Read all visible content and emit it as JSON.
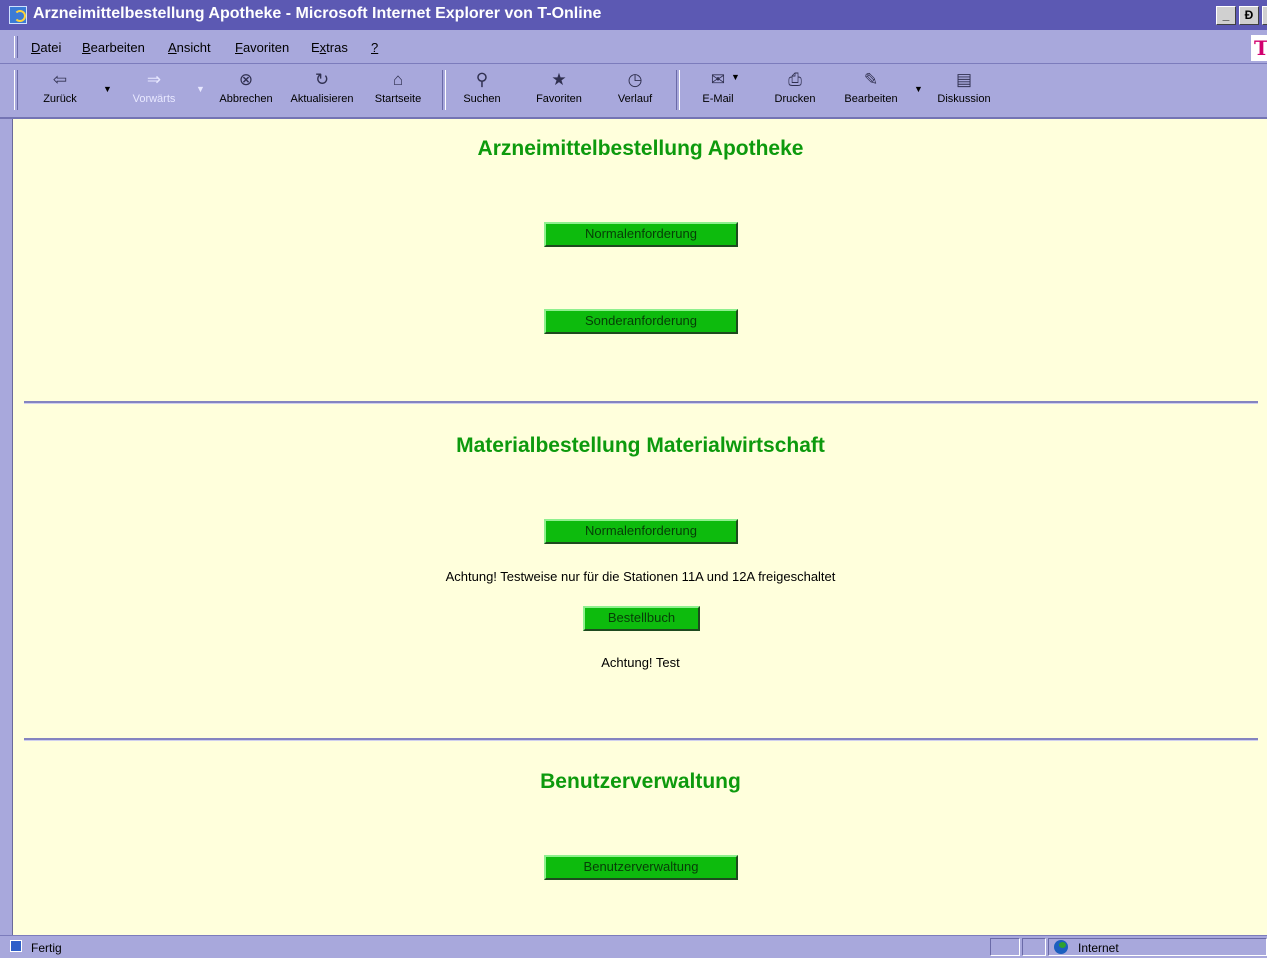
{
  "window": {
    "title": "Arzneimittelbestellung Apotheke - Microsoft Internet Explorer von T-Online",
    "controls": {
      "minimize": "_",
      "maximize": "Ɖ"
    }
  },
  "menubar": {
    "items": [
      {
        "pre": "",
        "accel": "D",
        "post": "atei"
      },
      {
        "pre": "",
        "accel": "B",
        "post": "earbeiten"
      },
      {
        "pre": "",
        "accel": "A",
        "post": "nsicht"
      },
      {
        "pre": "",
        "accel": "F",
        "post": "avoriten"
      },
      {
        "pre": "E",
        "accel": "x",
        "post": "tras"
      },
      {
        "pre": "",
        "accel": "?",
        "post": ""
      }
    ],
    "brand": "T"
  },
  "toolbar": {
    "back": "Zurück",
    "forward": "Vorwärts",
    "stop": "Abbrechen",
    "refresh": "Aktualisieren",
    "home": "Startseite",
    "search": "Suchen",
    "favorites": "Favoriten",
    "history": "Verlauf",
    "mail": "E-Mail",
    "print": "Drucken",
    "edit": "Bearbeiten",
    "discuss": "Diskussion"
  },
  "page": {
    "section1": {
      "heading": "Arzneimittelbestellung Apotheke",
      "btn_normal": "Normalenforderung",
      "btn_sonder": "Sonderanforderung"
    },
    "section2": {
      "heading": "Materialbestellung Materialwirtschaft",
      "btn_normal": "Normalenforderung",
      "note1": "Achtung! Testweise nur für die Stationen 11A und 12A freigeschaltet",
      "btn_bestellbuch": "Bestellbuch",
      "note2": "Achtung! Test"
    },
    "section3": {
      "heading": "Benutzerverwaltung",
      "btn_user": "Benutzerverwaltung"
    }
  },
  "status": {
    "text": "Fertig",
    "zone": "Internet"
  }
}
